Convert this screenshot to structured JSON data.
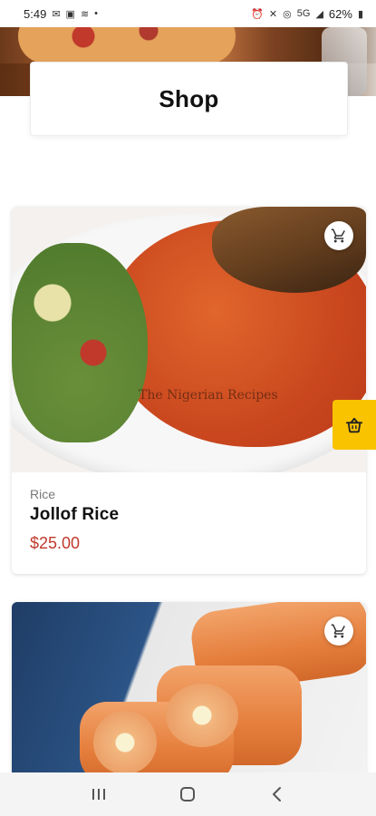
{
  "status_bar": {
    "time": "5:49",
    "left_icons": [
      "mail-icon",
      "image-icon",
      "wifi-calling-icon",
      "dot-icon"
    ],
    "network": "5G",
    "battery": "62%"
  },
  "page": {
    "title": "Shop"
  },
  "products": [
    {
      "category": "Rice",
      "name": "Jollof Rice",
      "price": "$25.00",
      "watermark": "The Nigerian Recipes"
    },
    {
      "category": "",
      "name": "",
      "price": ""
    }
  ],
  "colors": {
    "accent": "#f9c300",
    "price": "#c0392b"
  },
  "icons": {
    "cart": "cart-icon",
    "basket": "basket-icon"
  },
  "navigation": [
    "recent-apps-icon",
    "home-icon",
    "back-icon"
  ]
}
